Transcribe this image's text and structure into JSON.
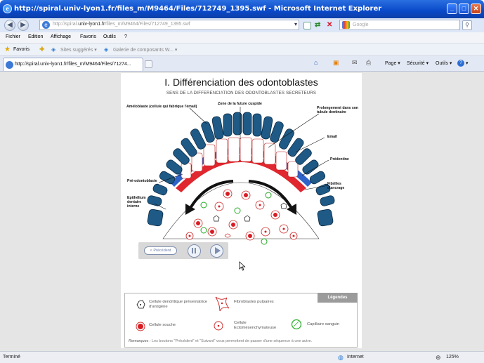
{
  "window": {
    "title": "http://spiral.univ-lyon1.fr/files_m/M9464/Files/712749_1395.swf - Microsoft Internet Explorer"
  },
  "address": {
    "prefix": "http://spiral.",
    "domain": "univ-lyon1.fr",
    "suffix": "/files_m/M9464/Files/712749_1395.swf"
  },
  "search": {
    "placeholder": "Google"
  },
  "menu": [
    "Fichier",
    "Edition",
    "Affichage",
    "Favoris",
    "Outils",
    "?"
  ],
  "favorites": {
    "label": "Favoris",
    "items": [
      "Sites suggérés ▾",
      "Galerie de composants W... ▾"
    ]
  },
  "tab": {
    "label": "http://spiral.univ-lyon1.fr/files_m/M9464/Files/71274..."
  },
  "commands": {
    "page": "Page ▾",
    "security": "Sécurité ▾",
    "tools": "Outils ▾",
    "help": "? ▾"
  },
  "slide": {
    "title": "I. Différenciation des odontoblastes",
    "subtitle": "SENS DE LA DIFFERENCIATION DES ODONTOBLASTES SECRETEURS",
    "labels": {
      "ameloblaste": "Améloblaste (cellule qui fabrique l'émail)",
      "zone_cuspide": "Zone de la future cuspide",
      "prolongement": "Prolongement dans son tubule dentinaire",
      "email": "Emaîl",
      "predentine": "Prédentine",
      "pre_odontoblaste": "Pré-odontoblaste",
      "fibrilles": "Fibrilles d'ancrage",
      "epithelium": "Epithélium dentaire interne"
    }
  },
  "player": {
    "prev_label": "< Précédent"
  },
  "legend": {
    "title": "Légendes",
    "dendritique": "Cellule dendritique présentatrice d'antigène",
    "fibroblastes": "Fibroblastes pulpaires",
    "souche": "Cellule souche",
    "ecto": "Cellule Ectomésenchymateuse",
    "capillaire": "Capillaire sanguin",
    "remarks_label": "Remarques :",
    "remarks_text": " Les boutons \"Précédent\" et \"Suivant\" vous permettent de passer d'une séquence à une autre."
  },
  "status": {
    "text": "Terminé",
    "zone": "Internet",
    "zoom": "125%"
  },
  "colors": {
    "ameloblast": "#1f5a86",
    "enamel": "#2e63c9",
    "predentin": "#e0262e",
    "stem": "#d81c24"
  }
}
